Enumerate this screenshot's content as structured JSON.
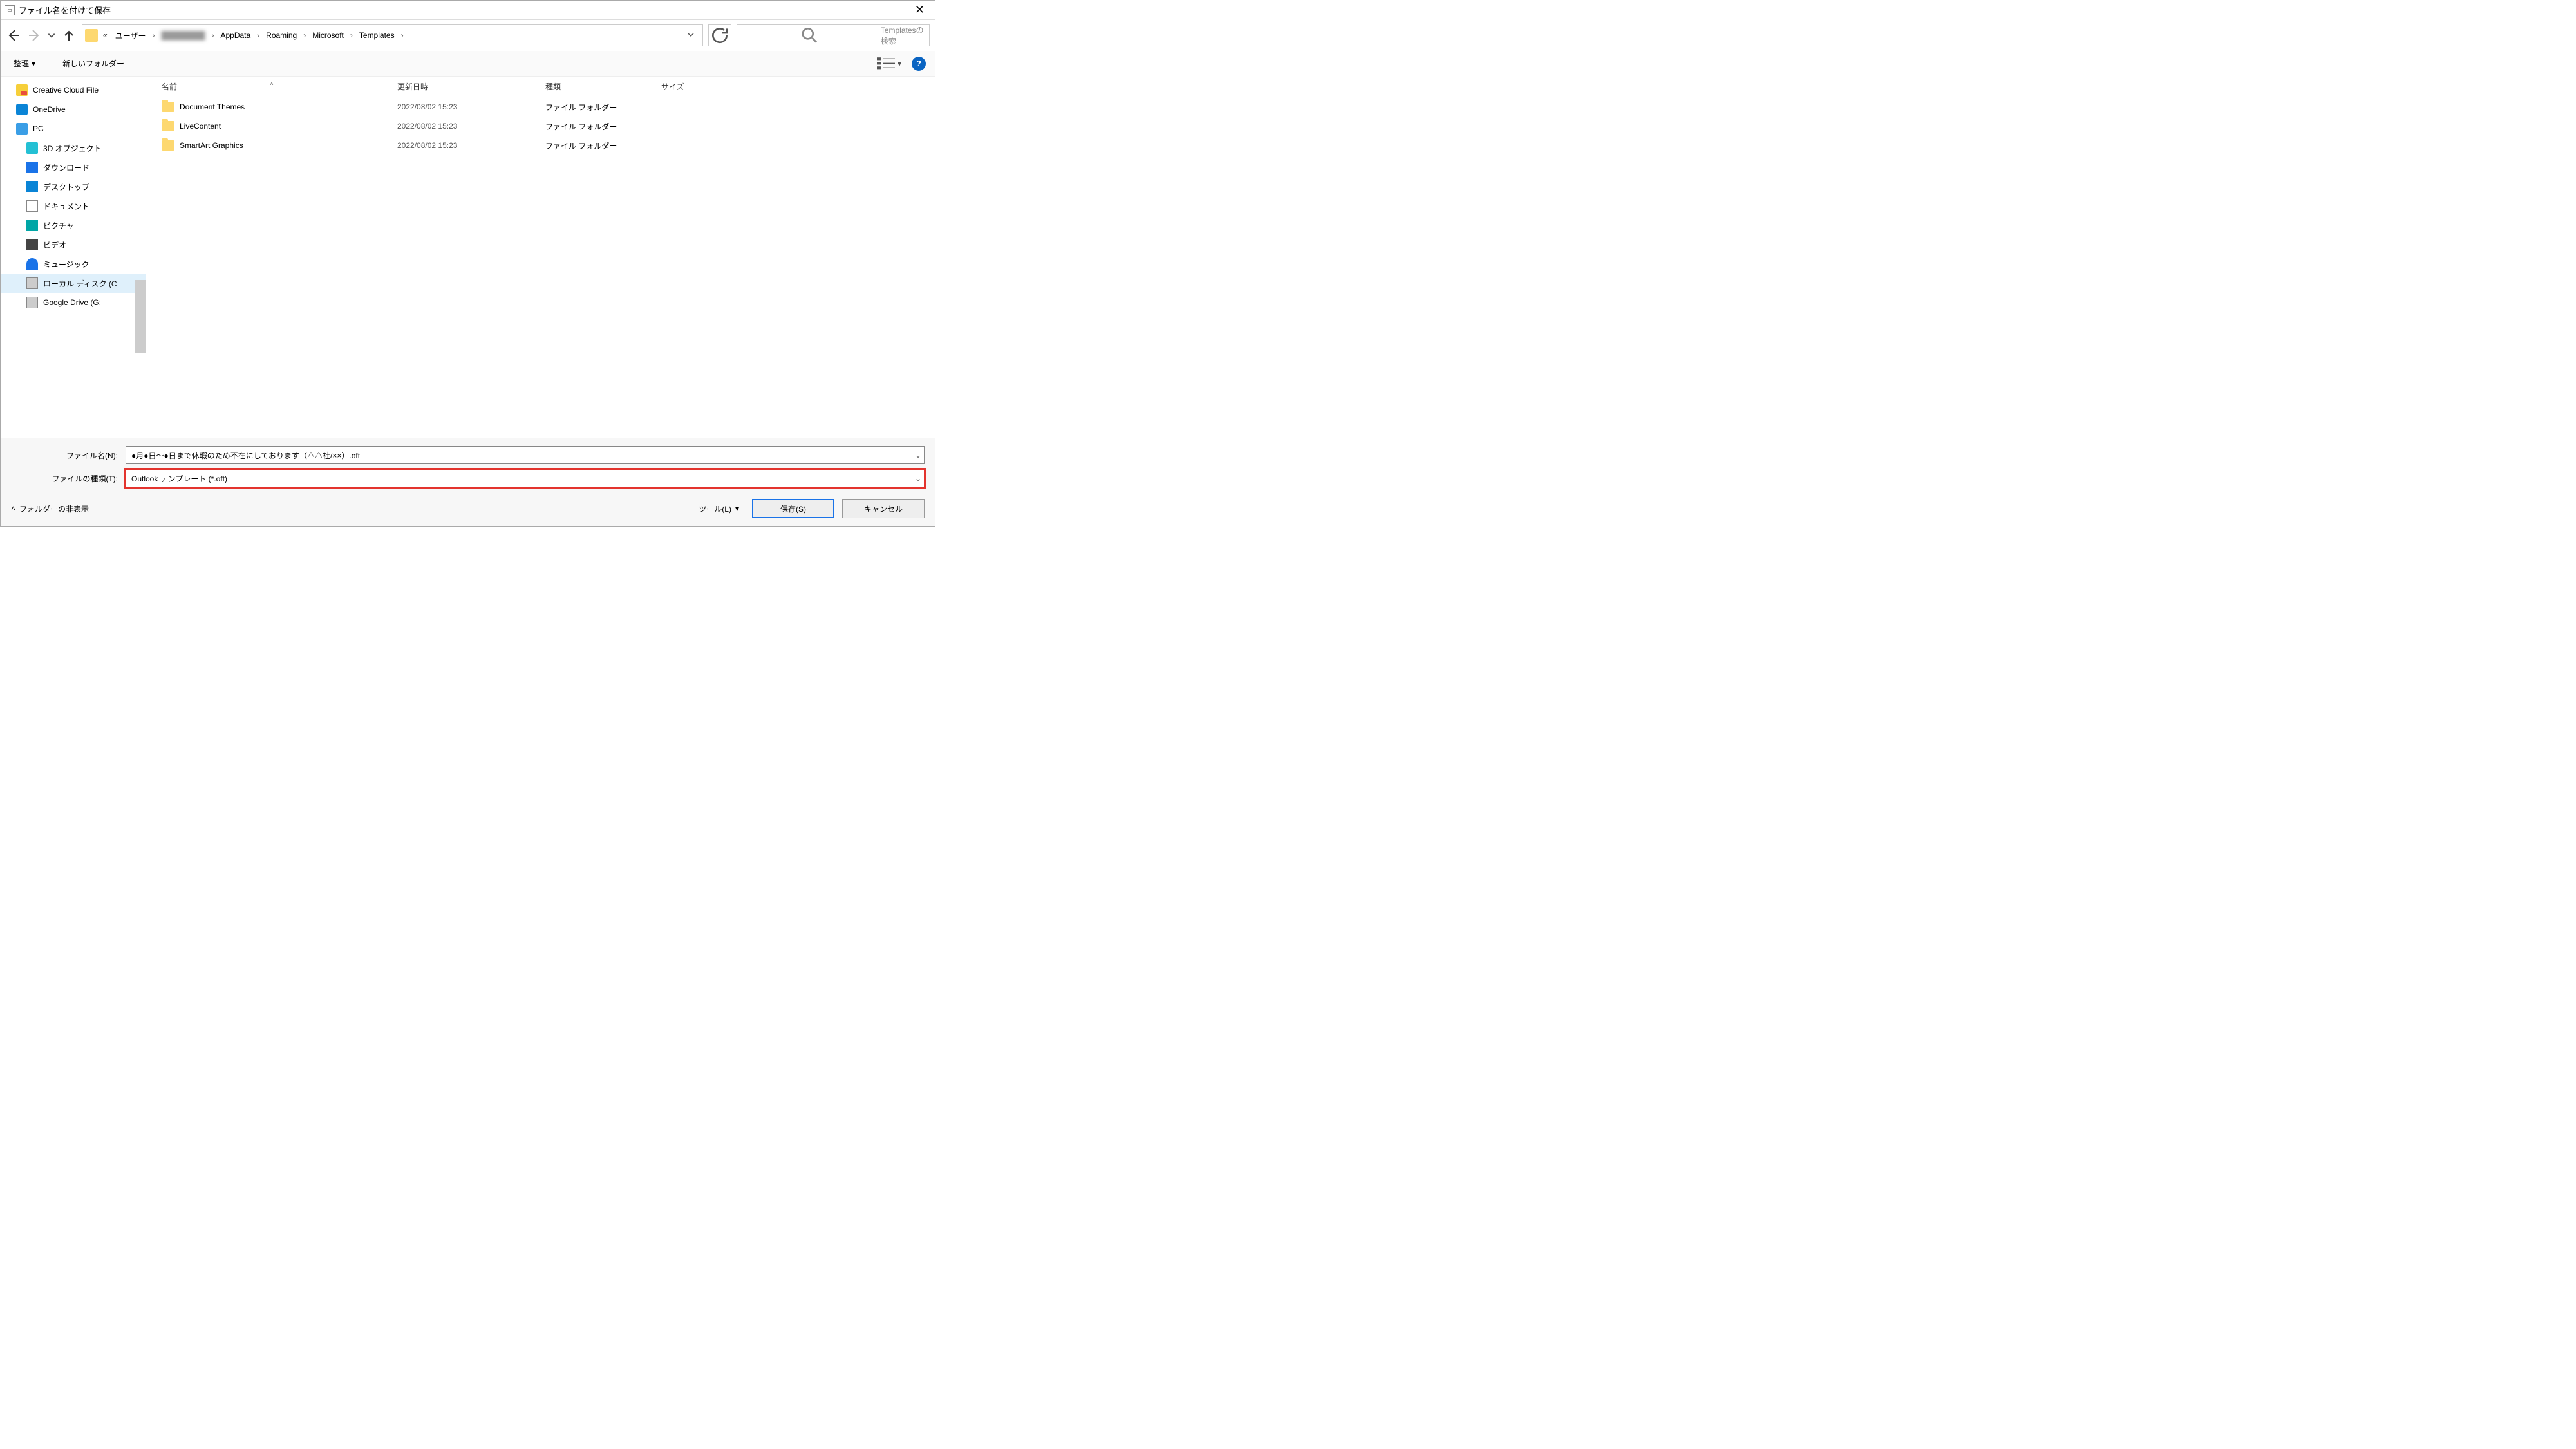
{
  "titlebar": {
    "title": "ファイル名を付けて保存"
  },
  "breadcrumb": {
    "prefix": "«",
    "segs": [
      "ユーザー",
      "",
      "AppData",
      "Roaming",
      "Microsoft",
      "Templates"
    ]
  },
  "search": {
    "placeholder": "Templatesの検索"
  },
  "toolbar": {
    "organize": "整理",
    "newfolder": "新しいフォルダー"
  },
  "tree": {
    "items": [
      {
        "label": "Creative Cloud File",
        "icon": "ic-cc",
        "lvl": 0
      },
      {
        "label": "OneDrive",
        "icon": "ic-od",
        "lvl": 0
      },
      {
        "label": "PC",
        "icon": "ic-pc",
        "lvl": 0
      },
      {
        "label": "3D オブジェクト",
        "icon": "ic-3d",
        "lvl": 1
      },
      {
        "label": "ダウンロード",
        "icon": "ic-dl",
        "lvl": 1
      },
      {
        "label": "デスクトップ",
        "icon": "ic-dt",
        "lvl": 1
      },
      {
        "label": "ドキュメント",
        "icon": "ic-doc",
        "lvl": 1
      },
      {
        "label": "ピクチャ",
        "icon": "ic-pic",
        "lvl": 1
      },
      {
        "label": "ビデオ",
        "icon": "ic-vid",
        "lvl": 1
      },
      {
        "label": "ミュージック",
        "icon": "ic-mus",
        "lvl": 1
      },
      {
        "label": "ローカル ディスク (C",
        "icon": "ic-drv",
        "lvl": 1,
        "sel": true
      },
      {
        "label": "Google Drive (G:",
        "icon": "ic-drv",
        "lvl": 1
      }
    ]
  },
  "columns": {
    "name": "名前",
    "date": "更新日時",
    "type": "種類",
    "size": "サイズ"
  },
  "rows": [
    {
      "name": "Document Themes",
      "date": "2022/08/02 15:23",
      "type": "ファイル フォルダー"
    },
    {
      "name": "LiveContent",
      "date": "2022/08/02 15:23",
      "type": "ファイル フォルダー"
    },
    {
      "name": "SmartArt Graphics",
      "date": "2022/08/02 15:23",
      "type": "ファイル フォルダー"
    }
  ],
  "filename": {
    "label": "ファイル名(N):",
    "value": "●月●日～●日まで休暇のため不在にしております（△△社/××）.oft"
  },
  "filetype": {
    "label": "ファイルの種類(T):",
    "value": "Outlook テンプレート (*.oft)"
  },
  "footer": {
    "hide": "フォルダーの非表示",
    "tool": "ツール(L)",
    "save": "保存(S)",
    "cancel": "キャンセル"
  }
}
